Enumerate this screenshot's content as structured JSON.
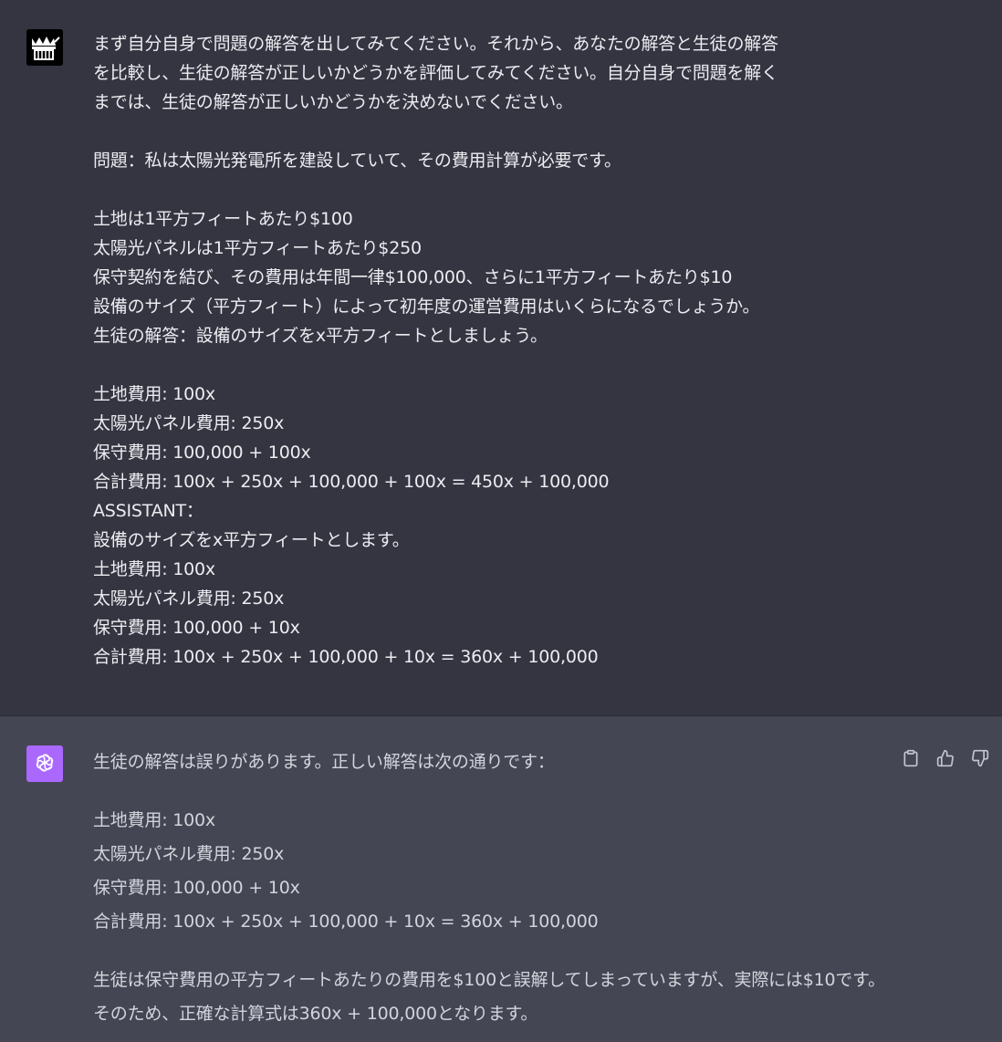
{
  "user": {
    "avatar_icon": "crown-hand-logo-icon",
    "intro_lines": [
      "まず自分自身で問題の解答を出してみてください。それから、あなたの解答と生徒の解答",
      "を比較し、生徒の解答が正しいかどうかを評価してみてください。自分自身で問題を解く",
      "までは、生徒の解答が正しいかどうかを決めないでください。"
    ],
    "problem_line": "問題：私は太陽光発電所を建設していて、その費用計算が必要です。",
    "details_lines": [
      "土地は1平方フィートあたり$100",
      "太陽光パネルは1平方フィートあたり$250",
      "保守契約を結び、その費用は年間一律$100,000、さらに1平方フィートあたり$10",
      "設備のサイズ（平方フィート）によって初年度の運営費用はいくらになるでしょうか。",
      "生徒の解答：設備のサイズをx平方フィートとしましょう。"
    ],
    "student_lines": [
      "土地費用: 100x",
      "太陽光パネル費用: 250x",
      "保守費用: 100,000 + 100x",
      "合計費用: 100x + 250x + 100,000 + 100x = 450x + 100,000",
      "ASSISTANT：",
      "設備のサイズをx平方フィートとします。",
      "土地費用: 100x",
      "太陽光パネル費用: 250x",
      "保守費用: 100,000 + 10x",
      "合計費用: 100x + 250x + 100,000 + 10x = 360x + 100,000"
    ]
  },
  "assistant": {
    "avatar_icon": "openai-logo-icon",
    "verdict": "生徒の解答は誤りがあります。正しい解答は次の通りです：",
    "solution_lines": [
      "土地費用: 100x",
      "太陽光パネル費用: 250x",
      "保守費用: 100,000 + 10x",
      "合計費用: 100x + 250x + 100,000 + 10x = 360x + 100,000"
    ],
    "explanation": "生徒は保守費用の平方フィートあたりの費用を$100と誤解してしまっていますが、実際には$10です。そのため、正確な計算式は360x + 100,000となります。",
    "actions": [
      {
        "name": "copy-button",
        "icon": "clipboard-icon"
      },
      {
        "name": "thumbs-up-button",
        "icon": "thumbs-up-icon"
      },
      {
        "name": "thumbs-down-button",
        "icon": "thumbs-down-icon"
      }
    ]
  },
  "colors": {
    "page_bg": "#343541",
    "assistant_bg": "#444654",
    "text": "#ececf1",
    "assistant_text": "#d1d5db",
    "assistant_avatar": "#ab68ff",
    "icon": "#c5c5d2"
  }
}
